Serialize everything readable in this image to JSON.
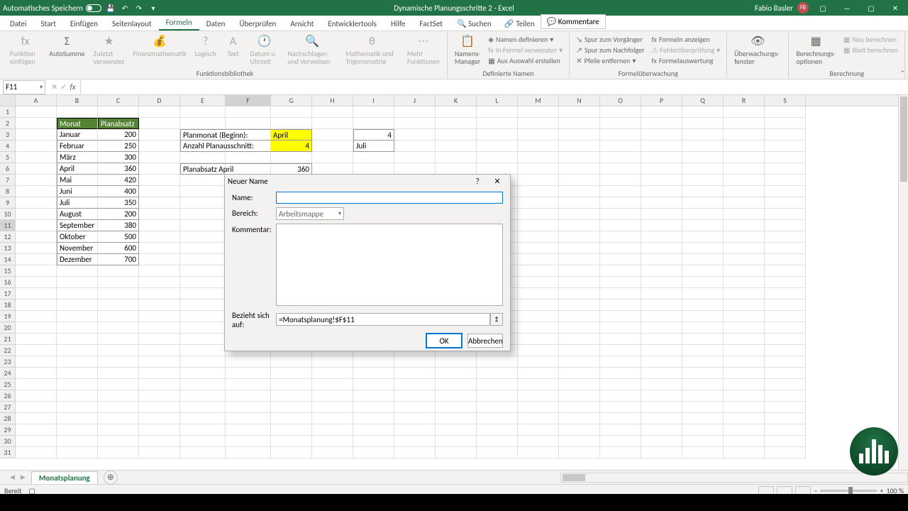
{
  "titlebar": {
    "auto_save": "Automatisches Speichern",
    "doc_title": "Dynamische Planungsschritte 2 - Excel",
    "user_name": "Fabio Basler",
    "user_initials": "FB"
  },
  "tabs": {
    "datei": "Datei",
    "start": "Start",
    "einfuegen": "Einfügen",
    "seitenlayout": "Seitenlayout",
    "formeln": "Formeln",
    "daten": "Daten",
    "ueberpruefen": "Überprüfen",
    "ansicht": "Ansicht",
    "entwicklertools": "Entwicklertools",
    "hilfe": "Hilfe",
    "factset": "FactSet",
    "suchen": "Suchen",
    "teilen": "Teilen",
    "kommentare": "Kommentare"
  },
  "ribbon": {
    "funktion_einfuegen": "Funktion einfügen",
    "autosumme": "AutoSumme",
    "zuletzt": "Zuletzt verwendet",
    "finanz": "Finanzmathematik",
    "logisch": "Logisch",
    "text": "Text",
    "datum": "Datum u. Uhrzeit",
    "nachschlagen": "Nachschlagen und Verweisen",
    "mathe": "Mathematik und Trigonometrie",
    "mehr": "Mehr Funktionen",
    "funktionsbib": "Funktionsbibliothek",
    "namens_manager": "Namens-Manager",
    "namen_def": "Namen definieren",
    "in_formel": "In Formel verwenden",
    "aus_auswahl": "Aus Auswahl erstellen",
    "definierte_namen": "Definierte Namen",
    "spur_vor": "Spur zum Vorgänger",
    "spur_nach": "Spur zum Nachfolger",
    "pfeile": "Pfeile entfernen",
    "formeln_anz": "Formeln anzeigen",
    "fehler": "Fehlerüberprüfung",
    "formelaus": "Formelauswertung",
    "formeluber": "Formelüberwachung",
    "fenster": "Überwachungs-fenster",
    "berech_opt": "Berechnungs-optionen",
    "neu_ber": "Neu berechnen",
    "blatt_ber": "Blatt berechnen",
    "berechnung": "Berechnung"
  },
  "namebox": "F11",
  "columns": [
    "A",
    "B",
    "C",
    "D",
    "E",
    "F",
    "G",
    "H",
    "I",
    "J",
    "K",
    "L",
    "M",
    "N",
    "O",
    "P",
    "Q",
    "R",
    "S"
  ],
  "data": {
    "hdr_monat": "Monat",
    "hdr_planabsatz": "Planabsatz",
    "months": [
      "Januar",
      "Februar",
      "März",
      "April",
      "Mai",
      "Juni",
      "Juli",
      "August",
      "September",
      "Oktober",
      "November",
      "Dezember"
    ],
    "values": [
      "200",
      "250",
      "300",
      "360",
      "420",
      "400",
      "350",
      "200",
      "380",
      "500",
      "600",
      "700"
    ],
    "planmonat_lbl": "Planmonat (Beginn):",
    "planmonat_val": "April",
    "anzahl_lbl": "Anzahl Planausschnitt:",
    "anzahl_val": "4",
    "i3": "4",
    "i4": "Juli",
    "planabsatz_april": "Planabsatz April",
    "planabsatz_april_val": "360"
  },
  "dialog": {
    "title": "Neuer Name",
    "name_lbl": "Name:",
    "bereich_lbl": "Bereich:",
    "bereich_val": "Arbeitsmappe",
    "kommentar_lbl": "Kommentar:",
    "bezieht_lbl": "Bezieht sich auf:",
    "bezieht_val": "=Monatsplanung!$F$11",
    "ok": "OK",
    "abbrechen": "Abbrechen"
  },
  "sheet_tab": "Monatsplanung",
  "status": {
    "bereit": "Bereit",
    "zoom": "100 %"
  }
}
